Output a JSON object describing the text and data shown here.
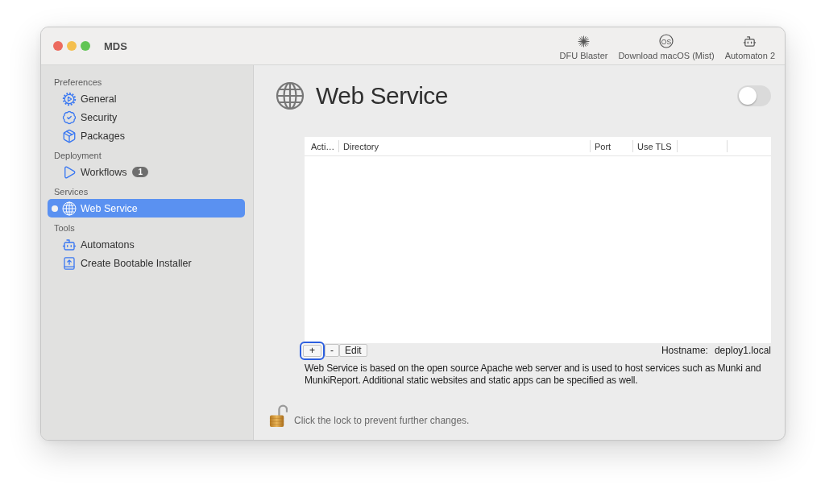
{
  "window": {
    "title": "MDS"
  },
  "toolbar": [
    {
      "label": "DFU Blaster"
    },
    {
      "label": "Download macOS (Mist)",
      "icon_text": "OS"
    },
    {
      "label": "Automaton 2"
    }
  ],
  "sidebar": {
    "sections": [
      {
        "title": "Preferences",
        "items": [
          {
            "label": "General",
            "selected": false,
            "status_dot": false
          },
          {
            "label": "Security",
            "selected": false,
            "status_dot": false
          },
          {
            "label": "Packages",
            "selected": false,
            "status_dot": false
          }
        ]
      },
      {
        "title": "Deployment",
        "items": [
          {
            "label": "Workflows",
            "selected": false,
            "status_dot": false,
            "badge": "1"
          }
        ]
      },
      {
        "title": "Services",
        "items": [
          {
            "label": "Web Service",
            "selected": true,
            "status_dot": true
          }
        ]
      },
      {
        "title": "Tools",
        "items": [
          {
            "label": "Automatons",
            "selected": false,
            "status_dot": false
          },
          {
            "label": "Create Bootable Installer",
            "selected": false,
            "status_dot": false
          }
        ]
      }
    ]
  },
  "header": {
    "title": "Web Service",
    "toggle": {
      "on": false
    }
  },
  "table": {
    "columns": [
      "Acti…",
      "Directory",
      "Port",
      "Use TLS"
    ]
  },
  "table_buttons": [
    {
      "label": "+",
      "focused": true
    },
    {
      "label": "-",
      "focused": false
    },
    {
      "label": "Edit",
      "focused": false
    }
  ],
  "hostname": {
    "label": "Hostname:",
    "value": "deploy1.local"
  },
  "description": "Web Service is based on the open source Apache web server and is used to host services such as Munki and MunkiReport. Additional static websites and static apps can be specified as well.",
  "lock": {
    "locked": false,
    "message": "Click the lock to prevent further changes."
  }
}
